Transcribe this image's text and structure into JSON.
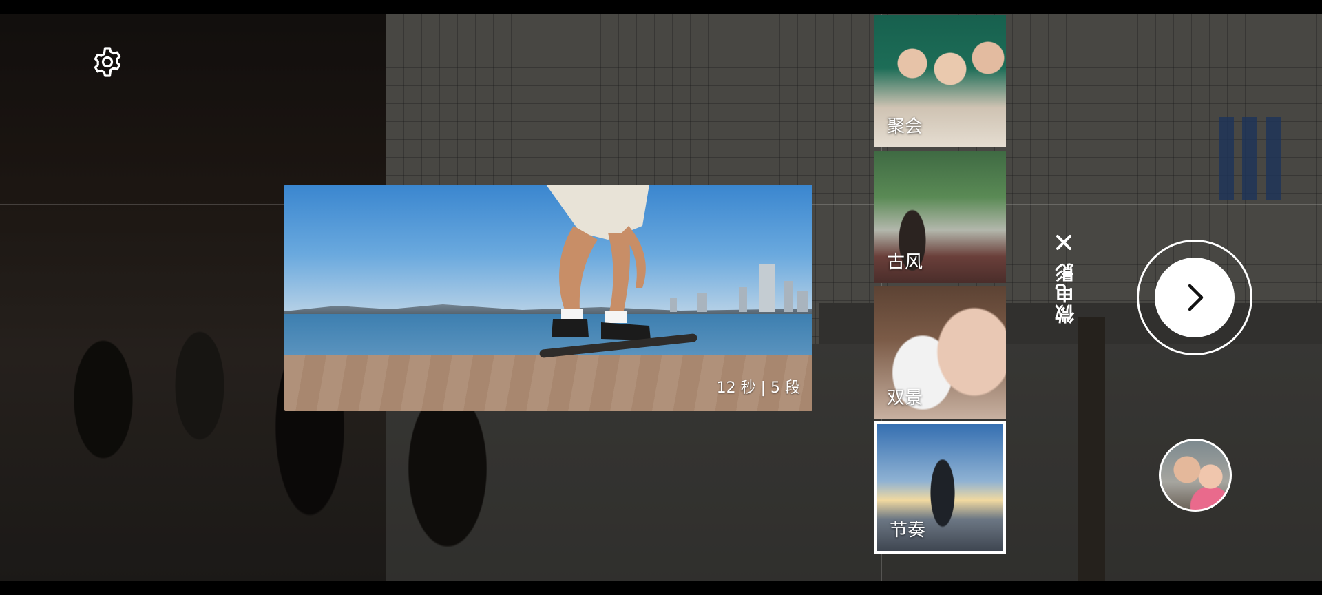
{
  "preview": {
    "caption": "12 秒 | 5 段"
  },
  "templates": [
    {
      "label": "聚会",
      "selected": false
    },
    {
      "label": "古风",
      "selected": false
    },
    {
      "label": "双景",
      "selected": false
    },
    {
      "label": "节奏",
      "selected": true
    }
  ],
  "mode": {
    "label": "微电影"
  },
  "icons": {
    "settings": "gear-icon",
    "close": "close-icon",
    "next": "chevron-right-icon"
  },
  "colors": {
    "accent": "#ffffff",
    "overlay": "#000000"
  }
}
